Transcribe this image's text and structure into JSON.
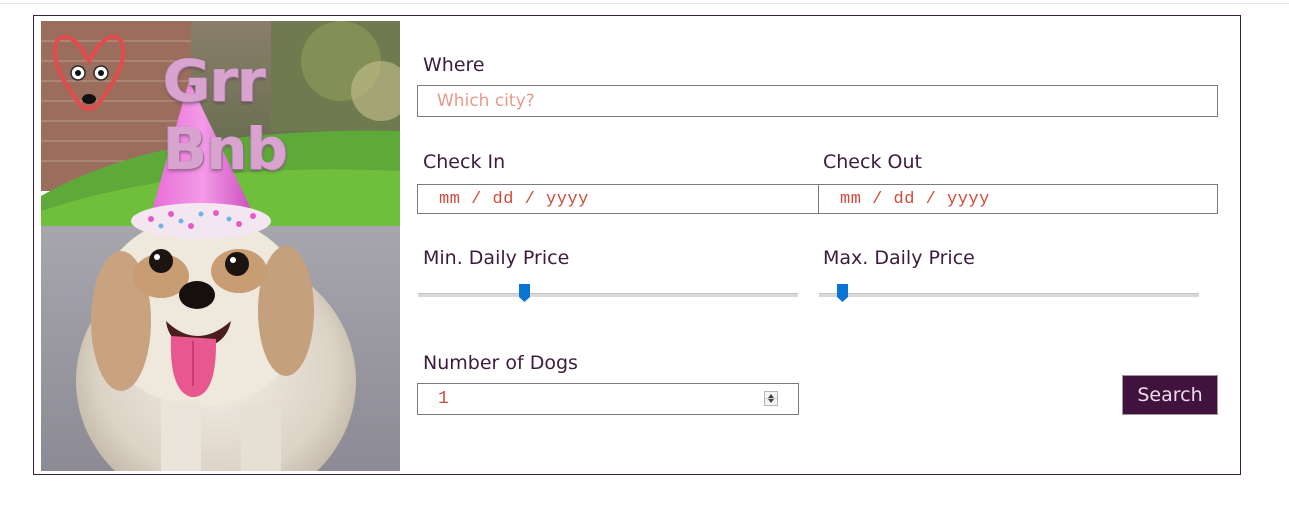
{
  "brand": {
    "name": "Grr Bnb",
    "logo_icon": "dog-face-logo-icon"
  },
  "hero": {
    "image": "dog-with-party-hat"
  },
  "form": {
    "where": {
      "label": "Where",
      "placeholder": "Which city?"
    },
    "check_in": {
      "label": "Check In",
      "placeholder": "mm / dd / yyyy"
    },
    "check_out": {
      "label": "Check Out",
      "placeholder": "mm / dd / yyyy"
    },
    "min_price": {
      "label": "Min. Daily Price",
      "fraction": 0.28
    },
    "max_price": {
      "label": "Max. Daily Price",
      "fraction": 0.06
    },
    "dogs": {
      "label": "Number of Dogs",
      "value": "1"
    },
    "search_label": "Search"
  },
  "colors": {
    "brand_purple": "#42123e",
    "label_text": "#3c1c3c",
    "placeholder": "#e59a8c",
    "input_text": "#d04a3c",
    "slider_thumb": "#0a74d4",
    "logo_red": "#e24b4b"
  }
}
